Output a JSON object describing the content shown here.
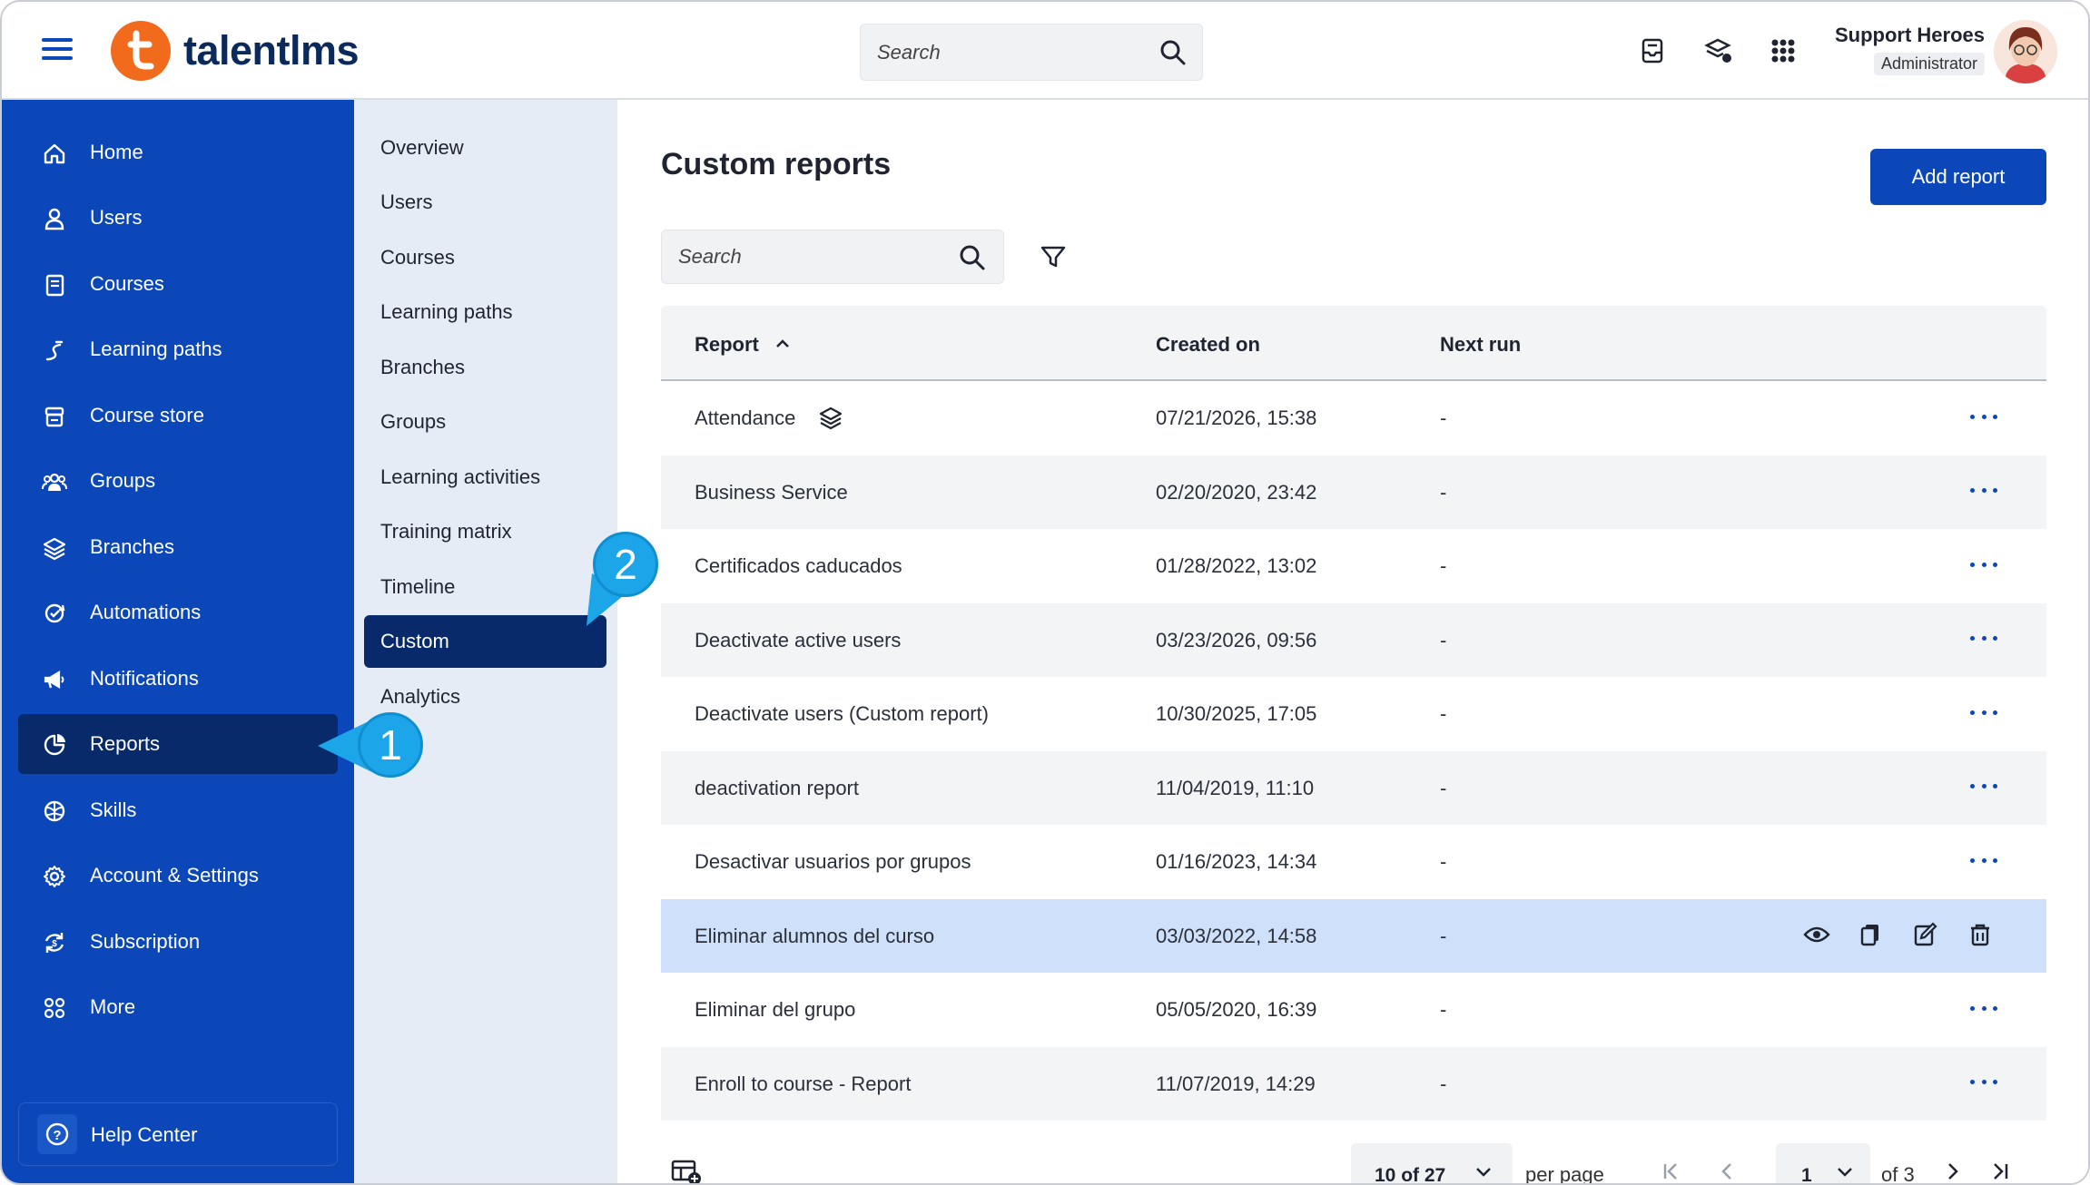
{
  "header": {
    "logo_text": "talentlms",
    "search_placeholder": "Search",
    "user_name": "Support Heroes",
    "user_role": "Administrator"
  },
  "sidebar": {
    "items": [
      {
        "label": "Home",
        "icon": "home-icon"
      },
      {
        "label": "Users",
        "icon": "user-icon"
      },
      {
        "label": "Courses",
        "icon": "book-icon"
      },
      {
        "label": "Learning paths",
        "icon": "path-icon"
      },
      {
        "label": "Course store",
        "icon": "store-icon"
      },
      {
        "label": "Groups",
        "icon": "groups-icon"
      },
      {
        "label": "Branches",
        "icon": "layers-icon"
      },
      {
        "label": "Automations",
        "icon": "automation-icon"
      },
      {
        "label": "Notifications",
        "icon": "megaphone-icon"
      },
      {
        "label": "Reports",
        "icon": "pie-chart-icon",
        "active": true
      },
      {
        "label": "Skills",
        "icon": "brain-icon"
      },
      {
        "label": "Account & Settings",
        "icon": "gear-icon"
      },
      {
        "label": "Subscription",
        "icon": "subscription-icon"
      },
      {
        "label": "More",
        "icon": "grid-dots-icon"
      }
    ],
    "help_label": "Help Center"
  },
  "subnav": {
    "items": [
      {
        "label": "Overview"
      },
      {
        "label": "Users"
      },
      {
        "label": "Courses"
      },
      {
        "label": "Learning paths"
      },
      {
        "label": "Branches"
      },
      {
        "label": "Groups"
      },
      {
        "label": "Learning activities"
      },
      {
        "label": "Training matrix"
      },
      {
        "label": "Timeline"
      },
      {
        "label": "Custom",
        "active": true
      },
      {
        "label": "Analytics"
      }
    ]
  },
  "callouts": [
    "1",
    "2"
  ],
  "main": {
    "title": "Custom reports",
    "add_button": "Add report",
    "search_placeholder": "Search",
    "columns": [
      "Report",
      "Created on",
      "Next run"
    ],
    "rows": [
      {
        "report": "Attendance",
        "created": "07/21/2026, 15:38",
        "next": "-"
      },
      {
        "report": "Business Service",
        "created": "02/20/2020, 23:42",
        "next": "-"
      },
      {
        "report": "Certificados caducados",
        "created": "01/28/2022, 13:02",
        "next": "-"
      },
      {
        "report": "Deactivate active users",
        "created": "03/23/2026, 09:56",
        "next": "-"
      },
      {
        "report": "Deactivate users (Custom report)",
        "created": "10/30/2025, 17:05",
        "next": "-"
      },
      {
        "report": "deactivation report",
        "created": "11/04/2019, 11:10",
        "next": "-"
      },
      {
        "report": "Desactivar usuarios por grupos",
        "created": "01/16/2023, 14:34",
        "next": "-"
      },
      {
        "report": "Eliminar alumnos del curso",
        "created": "03/03/2022, 14:58",
        "next": "-"
      },
      {
        "report": "Eliminar del grupo",
        "created": "05/05/2020, 16:39",
        "next": "-"
      },
      {
        "report": "Enroll to course - Report",
        "created": "11/07/2019, 14:29",
        "next": "-"
      }
    ],
    "pagination": {
      "per_page_value": "10 of 27",
      "per_page_label": "per page",
      "current_page": "1",
      "of_pages": "of 3"
    }
  },
  "colors": {
    "sidebar": "#0b47b8",
    "active": "#082a6b",
    "subnav": "#e6ecf6",
    "highlight_row": "#cfe0fb",
    "callout": "#1ca5e8",
    "brand_orange": "#f26a1b"
  }
}
